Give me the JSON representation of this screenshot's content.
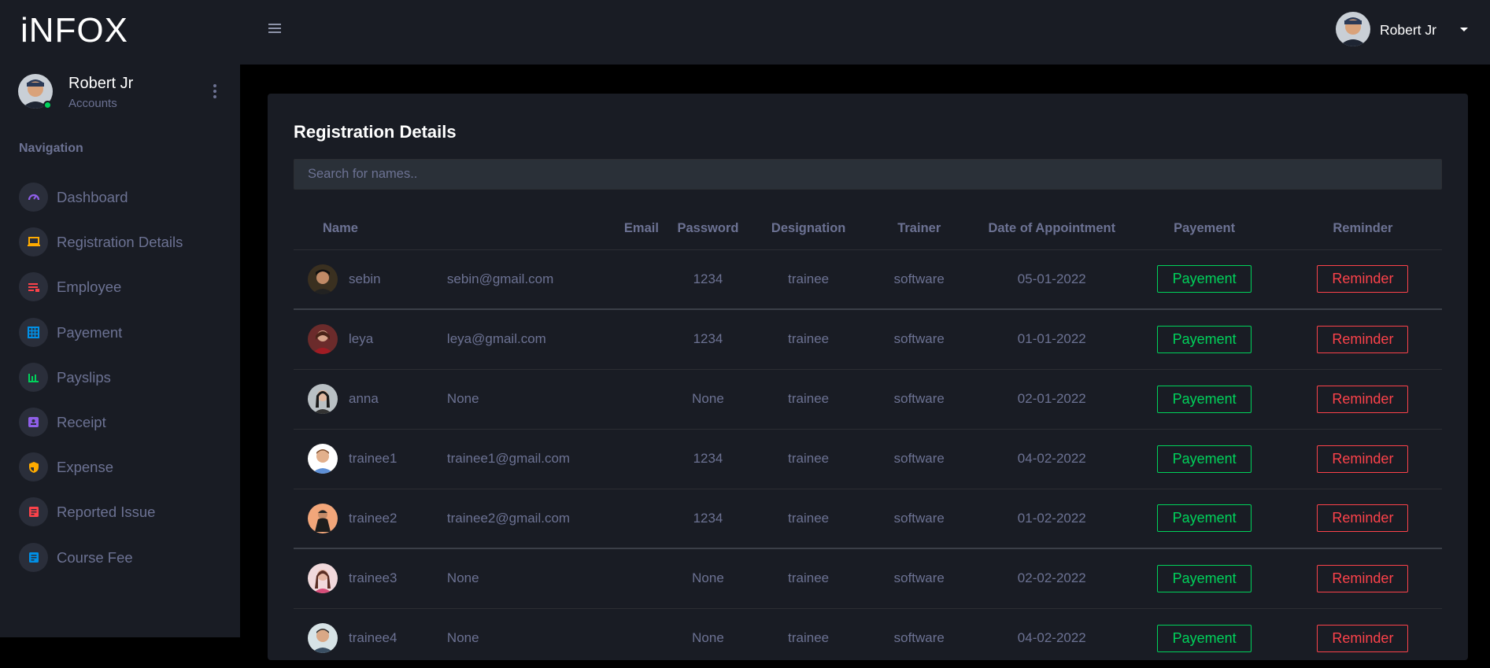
{
  "app": {
    "brand": "iNFOX"
  },
  "profile": {
    "name": "Robert Jr",
    "role": "Accounts"
  },
  "nav": {
    "heading": "Navigation",
    "items": [
      {
        "label": "Dashboard",
        "icon": "speedometer-icon",
        "color": "#8f5fe8"
      },
      {
        "label": "Registration Details",
        "icon": "laptop-icon",
        "color": "#ffab00"
      },
      {
        "label": "Employee",
        "icon": "list-icon",
        "color": "#fc424a"
      },
      {
        "label": "Payement",
        "icon": "table-icon",
        "color": "#0090e7"
      },
      {
        "label": "Payslips",
        "icon": "bar-chart-icon",
        "color": "#00d25b"
      },
      {
        "label": "Receipt",
        "icon": "contacts-icon",
        "color": "#8f5fe8"
      },
      {
        "label": "Expense",
        "icon": "security-icon",
        "color": "#ffab00"
      },
      {
        "label": "Reported Issue",
        "icon": "form-icon",
        "color": "#fc424a"
      },
      {
        "label": "Course Fee",
        "icon": "document-icon",
        "color": "#0090e7"
      }
    ]
  },
  "topbar": {
    "user_name": "Robert Jr"
  },
  "main": {
    "title": "Registration Details",
    "search_placeholder": "Search for names..",
    "columns": [
      "Name",
      "Email",
      "Password",
      "Designation",
      "Trainer",
      "Date of Appointment",
      "Payement",
      "Reminder"
    ],
    "rows": [
      {
        "name": "sebin",
        "email": "sebin@gmail.com",
        "password": "1234",
        "designation": "trainee",
        "trainer": "software",
        "date": "05-01-2022",
        "payment_label": "Payement",
        "reminder_label": "Reminder"
      },
      {
        "name": "leya",
        "email": "leya@gmail.com",
        "password": "1234",
        "designation": "trainee",
        "trainer": "software",
        "date": "01-01-2022",
        "payment_label": "Payement",
        "reminder_label": "Reminder"
      },
      {
        "name": "anna",
        "email": "None",
        "password": "None",
        "designation": "trainee",
        "trainer": "software",
        "date": "02-01-2022",
        "payment_label": "Payement",
        "reminder_label": "Reminder"
      },
      {
        "name": "trainee1",
        "email": "trainee1@gmail.com",
        "password": "1234",
        "designation": "trainee",
        "trainer": "software",
        "date": "04-02-2022",
        "payment_label": "Payement",
        "reminder_label": "Reminder"
      },
      {
        "name": "trainee2",
        "email": "trainee2@gmail.com",
        "password": "1234",
        "designation": "trainee",
        "trainer": "software",
        "date": "01-02-2022",
        "payment_label": "Payement",
        "reminder_label": "Reminder"
      },
      {
        "name": "trainee3",
        "email": "None",
        "password": "None",
        "designation": "trainee",
        "trainer": "software",
        "date": "02-02-2022",
        "payment_label": "Payement",
        "reminder_label": "Reminder"
      },
      {
        "name": "trainee4",
        "email": "None",
        "password": "None",
        "designation": "trainee",
        "trainer": "software",
        "date": "04-02-2022",
        "payment_label": "Payement",
        "reminder_label": "Reminder"
      }
    ]
  }
}
